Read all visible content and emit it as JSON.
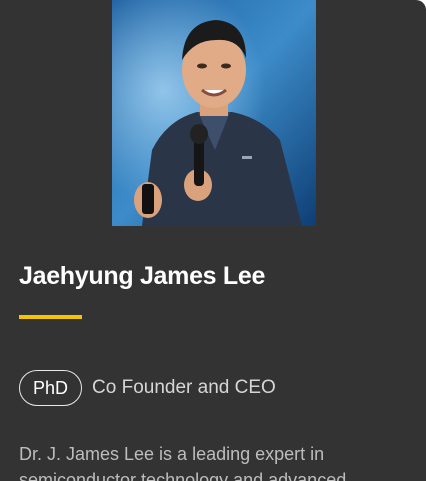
{
  "profile": {
    "name": "Jaehyung James Lee",
    "degree": "PhD",
    "title": "Co Founder and CEO",
    "bio": "Dr. J. James Lee is a leading expert in semiconductor technology and advanced"
  },
  "colors": {
    "card_background": "#333333",
    "accent": "#f5c400"
  },
  "icons": {
    "photo": "speaker-portrait"
  }
}
